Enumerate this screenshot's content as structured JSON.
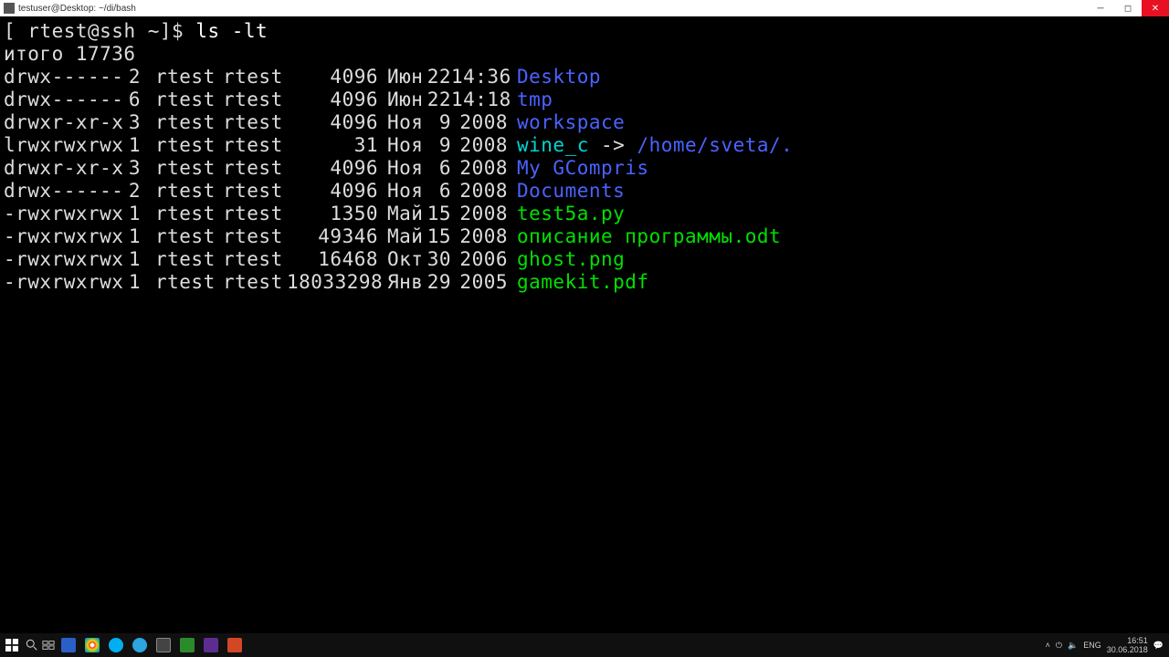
{
  "window": {
    "title": "testuser@Desktop: ~/di/bash"
  },
  "prompt": {
    "bracket_open": "[ ",
    "userhost": "rtest@ssh",
    "path": " ~",
    "bracket_close": "]$ ",
    "command": "ls -lt"
  },
  "total_line": "итого 17736",
  "rows": [
    {
      "perm": "drwx------",
      "links": "2",
      "owner": "rtest",
      "group": "rtest",
      "size": "4096",
      "month": "Июн",
      "day": "22",
      "timeyr": "14:36",
      "name": "Desktop",
      "cls": "dir"
    },
    {
      "perm": "drwx------",
      "links": "6",
      "owner": "rtest",
      "group": "rtest",
      "size": "4096",
      "month": "Июн",
      "day": "22",
      "timeyr": "14:18",
      "name": "tmp",
      "cls": "dir"
    },
    {
      "perm": "drwxr-xr-x",
      "links": "3",
      "owner": "rtest",
      "group": "rtest",
      "size": "4096",
      "month": "Ноя",
      "day": "9",
      "timeyr": "2008",
      "name": "workspace",
      "cls": "dir"
    },
    {
      "perm": "lrwxrwxrwx",
      "links": "1",
      "owner": "rtest",
      "group": "rtest",
      "size": "31",
      "month": "Ноя",
      "day": "9",
      "timeyr": "2008",
      "name": "wine_c",
      "cls": "cyan",
      "arrow": " -> ",
      "target": "/home/sveta/.",
      "tcls": "dir"
    },
    {
      "perm": "drwxr-xr-x",
      "links": "3",
      "owner": "rtest",
      "group": "rtest",
      "size": "4096",
      "month": "Ноя",
      "day": "6",
      "timeyr": "2008",
      "name": "My GCompris",
      "cls": "dir"
    },
    {
      "perm": "drwx------",
      "links": "2",
      "owner": "rtest",
      "group": "rtest",
      "size": "4096",
      "month": "Ноя",
      "day": "6",
      "timeyr": "2008",
      "name": "Documents",
      "cls": "dir"
    },
    {
      "perm": "-rwxrwxrwx",
      "links": "1",
      "owner": "rtest",
      "group": "rtest",
      "size": "1350",
      "month": "Май",
      "day": "15",
      "timeyr": "2008",
      "name": "test5a.py",
      "cls": "exe"
    },
    {
      "perm": "-rwxrwxrwx",
      "links": "1",
      "owner": "rtest",
      "group": "rtest",
      "size": "49346",
      "month": "Май",
      "day": "15",
      "timeyr": "2008",
      "name": "описание программы.odt",
      "cls": "exe"
    },
    {
      "perm": "-rwxrwxrwx",
      "links": "1",
      "owner": "rtest",
      "group": "rtest",
      "size": "16468",
      "month": "Окт",
      "day": "30",
      "timeyr": "2006",
      "name": "ghost.png",
      "cls": "exe"
    },
    {
      "perm": "-rwxrwxrwx",
      "links": "1",
      "owner": "rtest",
      "group": "rtest",
      "size": "18033298",
      "month": "Янв",
      "day": "29",
      "timeyr": "2005",
      "name": "gamekit.pdf",
      "cls": "exe"
    }
  ],
  "taskbar": {
    "lang": "ENG",
    "time": "16:51",
    "date": "30.06.2018"
  }
}
